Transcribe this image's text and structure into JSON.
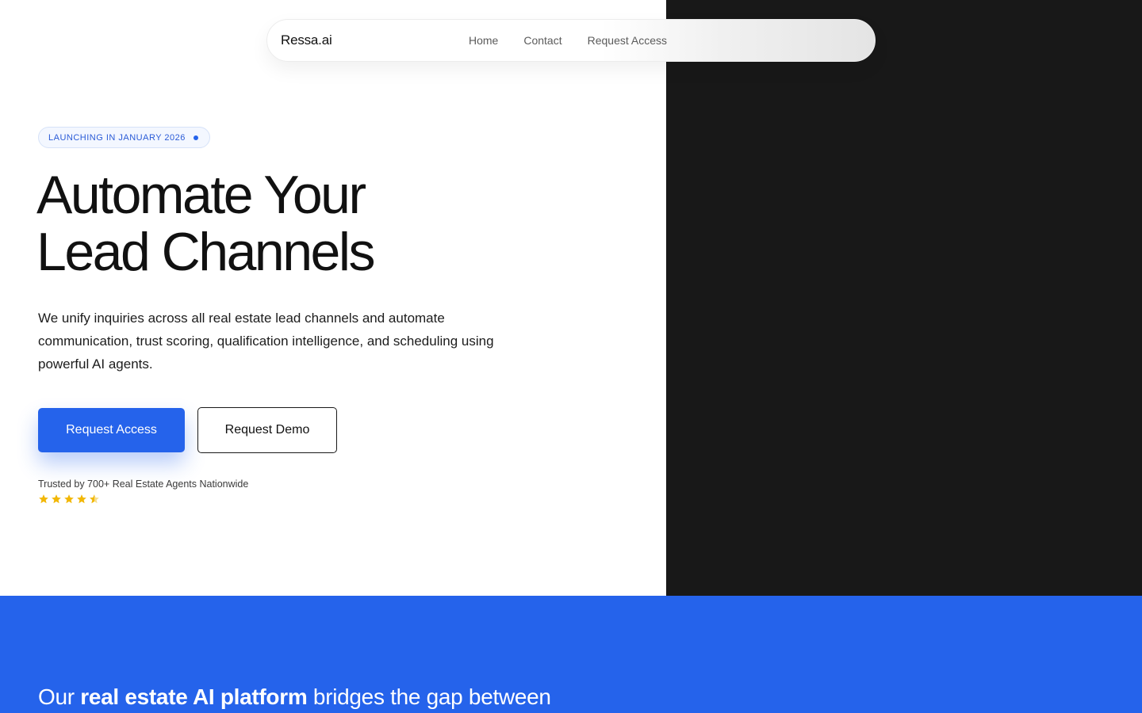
{
  "nav": {
    "brand": "Ressa.ai",
    "links": [
      {
        "label": "Home"
      },
      {
        "label": "Contact"
      },
      {
        "label": "Request Access"
      }
    ]
  },
  "hero": {
    "badge": "LAUNCHING IN JANUARY 2026",
    "headline_line1": "Automate Your",
    "headline_line2": "Lead Channels",
    "subtext": "We unify inquiries across all real estate lead channels and automate communication, trust scoring, qualification intelligence, and scheduling using powerful AI agents.",
    "primary_cta": "Request Access",
    "secondary_cta": "Request Demo",
    "trusted_text": "Trusted by 700+ Real Estate Agents Nationwide",
    "rating": 4.5
  },
  "section2": {
    "text_before": "Our ",
    "text_strong": "real estate AI platform",
    "text_after": " bridges the gap between"
  },
  "colors": {
    "accent": "#2563eb",
    "dark_panel": "#181818",
    "star": "#f2b705"
  },
  "icons": {
    "badge_dot": "dot-icon",
    "rating": "star-icon"
  }
}
